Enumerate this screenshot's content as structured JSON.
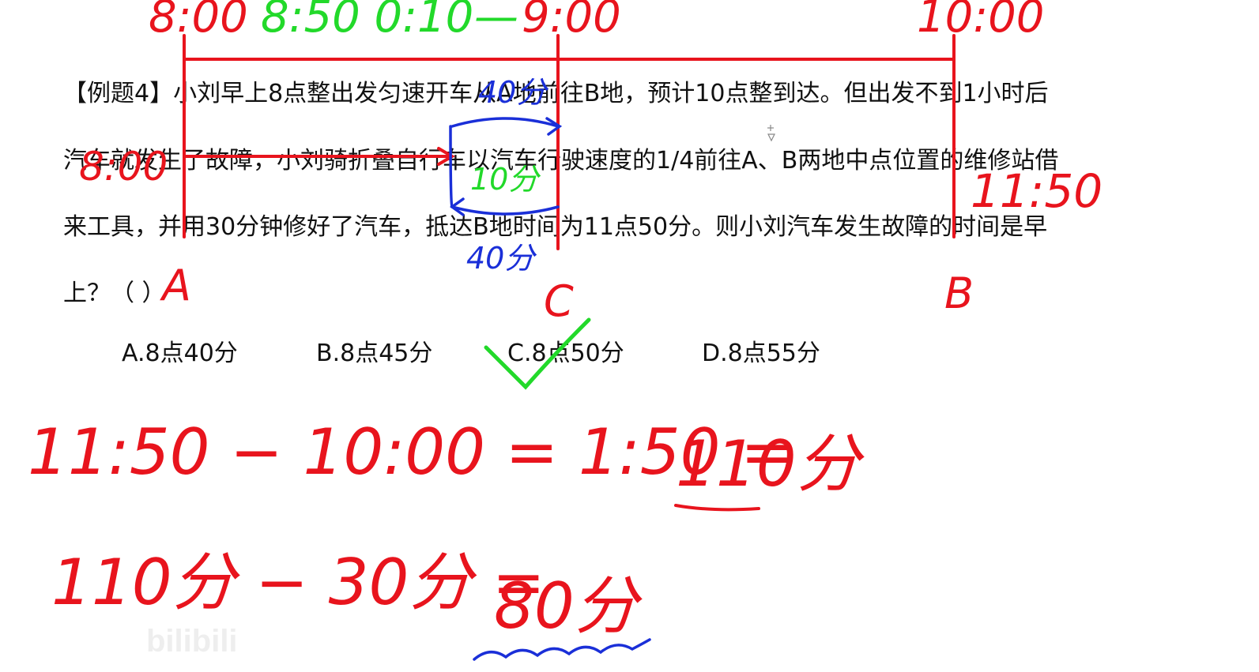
{
  "question": {
    "line1": "【例题4】小刘早上8点整出发匀速开车从A地前往B地，预计10点整到达。但出发不到1小时后",
    "line2": "汽车就发生了故障，小刘骑折叠自行车以汽车行驶速度的1/4前往A、B两地中点位置的维修站借",
    "line3": "来工具，并用30分钟修好了汽车，抵达B地时间为11点50分。则小刘汽车发生故障的时间是早",
    "line4": "上？（ ）"
  },
  "options": [
    {
      "label": "A.8点40分"
    },
    {
      "label": "B.8点45分"
    },
    {
      "label": "C.8点50分"
    },
    {
      "label": "D.8点55分"
    }
  ],
  "annotations": {
    "time_start": "8:00",
    "time_fault": "8:50 0:10",
    "time_mid": "9:00",
    "time_end": "10:00",
    "time_start2": "8:00",
    "time_arrive": "11:50",
    "seg_top": "40分",
    "seg_mid": "10分",
    "seg_bottom": "40分",
    "point_a": "A",
    "point_c": "C",
    "point_b": "B",
    "calc1_left": "11:50 − 10:00 = 1:50 =",
    "calc1_result": "110分",
    "calc2_left": "110分 − 30分 =",
    "calc2_result": "80分"
  },
  "watermark": "bilibili",
  "colors": {
    "red_ink": "#e8141d",
    "green_ink": "#22d92a",
    "blue_ink": "#1a2fd8",
    "text": "#111111"
  }
}
